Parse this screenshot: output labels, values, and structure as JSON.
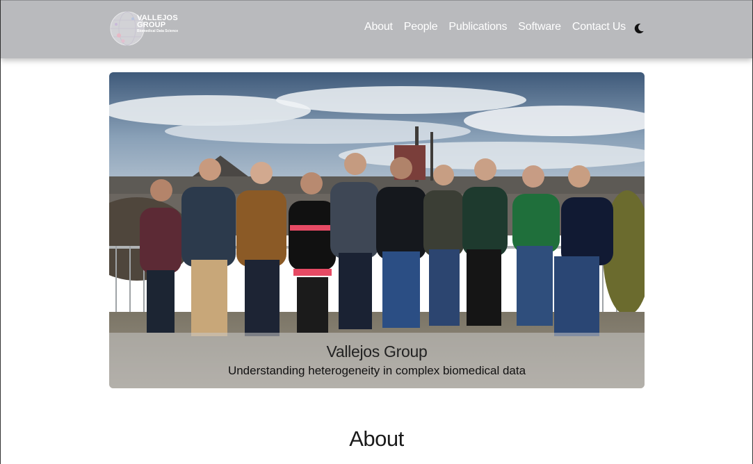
{
  "brand": {
    "name_line1": "VALLEJOS",
    "name_line2": "GROUP",
    "tagline": "Biomedical Data Science"
  },
  "nav": {
    "items": [
      {
        "label": "About"
      },
      {
        "label": "People"
      },
      {
        "label": "Publications"
      },
      {
        "label": "Software"
      },
      {
        "label": "Contact Us"
      }
    ],
    "theme_toggle_icon": "moon-icon"
  },
  "hero": {
    "title": "Vallejos Group",
    "subtitle": "Understanding heterogeneity in complex biomedical data"
  },
  "section": {
    "title": "About"
  },
  "colors": {
    "navbar_bg": "#b9babd",
    "nav_text": "#ffffff"
  }
}
